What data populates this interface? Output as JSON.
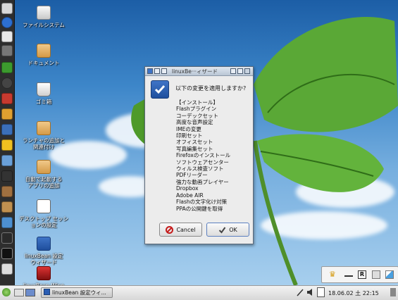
{
  "desktop_icons": [
    {
      "label": "ファイルシステム",
      "icon": "drive-icon"
    },
    {
      "label": "ドキュメント",
      "icon": "folder-icon"
    },
    {
      "label": "ゴミ箱",
      "icon": "trash-icon"
    },
    {
      "label": "ランチャの追加と\n関連付け",
      "icon": "gear-folder-icon"
    },
    {
      "label": "自動で起動する\nアプリの追加",
      "icon": "gear-folder-icon"
    },
    {
      "label": "デスクトップ セッシ\nョンの設定",
      "icon": "window-icon"
    },
    {
      "label": "linuxBean 設定\nウィザード",
      "icon": "checkbox-icon"
    },
    {
      "label": "linuxBean Wine",
      "icon": "wine-icon"
    }
  ],
  "dialog": {
    "title": "linuxBe···ィザード",
    "question": "以下の変更を適用しますか?",
    "items": [
      "【インストール】",
      "Flashプラグイン",
      "コーデックセット",
      "高度な音声設定",
      "IMEの変更",
      "印刷セット",
      "オフィスセット",
      "写真編集セット",
      "Firefoxのインストール",
      "ソフトウェアセンター",
      "ウィルス検査ソフト",
      "PDFリーダー",
      "強力な動画プレイヤー",
      "Dropbox",
      "Adobe AIR",
      "Flashの文字化け対策",
      "PPAの公開鍵を取得"
    ],
    "cancel_label": "Cancel",
    "ok_label": "OK"
  },
  "tray_panel": {
    "icons": [
      "crown-icon",
      "minimize-icon",
      "r-icon",
      "keyboard-icon",
      "eraser-icon"
    ]
  },
  "taskbar": {
    "task_label": "linuxBean 設定ウィ...",
    "clock": "18.06.02 土 22:15"
  },
  "colors": {
    "sky_top": "#1c5ea6",
    "sky_bottom": "#a7cfee",
    "leaf": "#4e9a2a",
    "dock": "#2e2e2e",
    "accent": "#2a5db3"
  }
}
